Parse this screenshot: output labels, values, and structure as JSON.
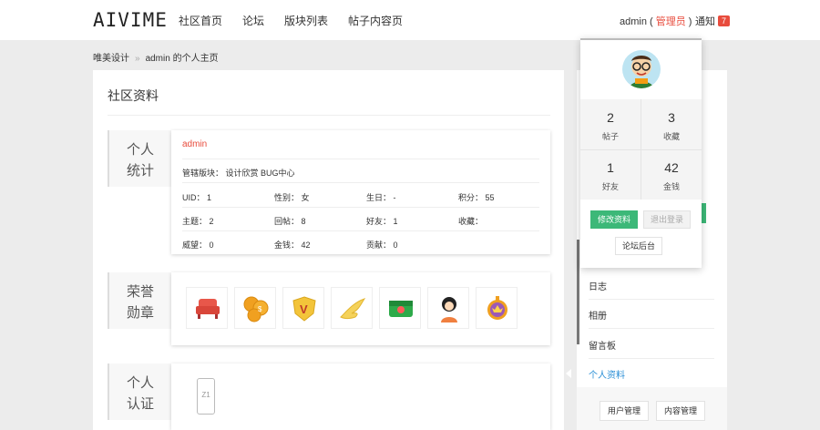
{
  "header": {
    "logo": "AIVIME",
    "nav": [
      "社区首页",
      "论坛",
      "版块列表",
      "帖子内容页"
    ],
    "user": "admin",
    "role_open": " ( ",
    "role": "管理员",
    "role_close": " )",
    "notice_label": "通知",
    "notice_count": "7"
  },
  "breadcrumb": {
    "home": "唯美设计",
    "sep": "»",
    "current": "admin 的个人主页"
  },
  "main": {
    "title": "社区资料",
    "stats_section": {
      "label_line1": "个人",
      "label_line2": "统计",
      "name": "admin",
      "moderator": "管辖版块：  设计欣赏  BUG中心",
      "stats": [
        "UID：  1",
        "性别：  女",
        "生日：  -",
        "积分：  55",
        "主题：  2",
        "回帖：  8",
        "好友：  1",
        "收藏：",
        "威望：  0",
        "金钱：  42",
        "贡献：  0"
      ]
    },
    "honor_section": {
      "label_line1": "荣誉",
      "label_line2": "勋章",
      "medals": [
        "sofa-icon",
        "coins-icon",
        "v-shield-icon",
        "wing-icon",
        "green-card-icon",
        "girl-avatar-icon",
        "crown-badge-icon"
      ]
    },
    "auth_section": {
      "label_line1": "个人",
      "label_line2": "认证",
      "phone_text": "Z1"
    }
  },
  "sidebar": {
    "items": [
      "日志",
      "相册",
      "留言板",
      "个人资料"
    ],
    "active": "个人资料",
    "buttons": [
      "用户管理",
      "内容管理"
    ]
  },
  "popup": {
    "stats": [
      {
        "num": "2",
        "label": "帖子"
      },
      {
        "num": "3",
        "label": "收藏"
      },
      {
        "num": "1",
        "label": "好友"
      },
      {
        "num": "42",
        "label": "金钱"
      }
    ],
    "edit_button": "修改资料",
    "logout_button": "退出登录",
    "admin_button": "论坛后台"
  },
  "colors": {
    "accent_red": "#e84c3d",
    "accent_green": "#3cb878",
    "link_blue": "#2a8fd6"
  }
}
